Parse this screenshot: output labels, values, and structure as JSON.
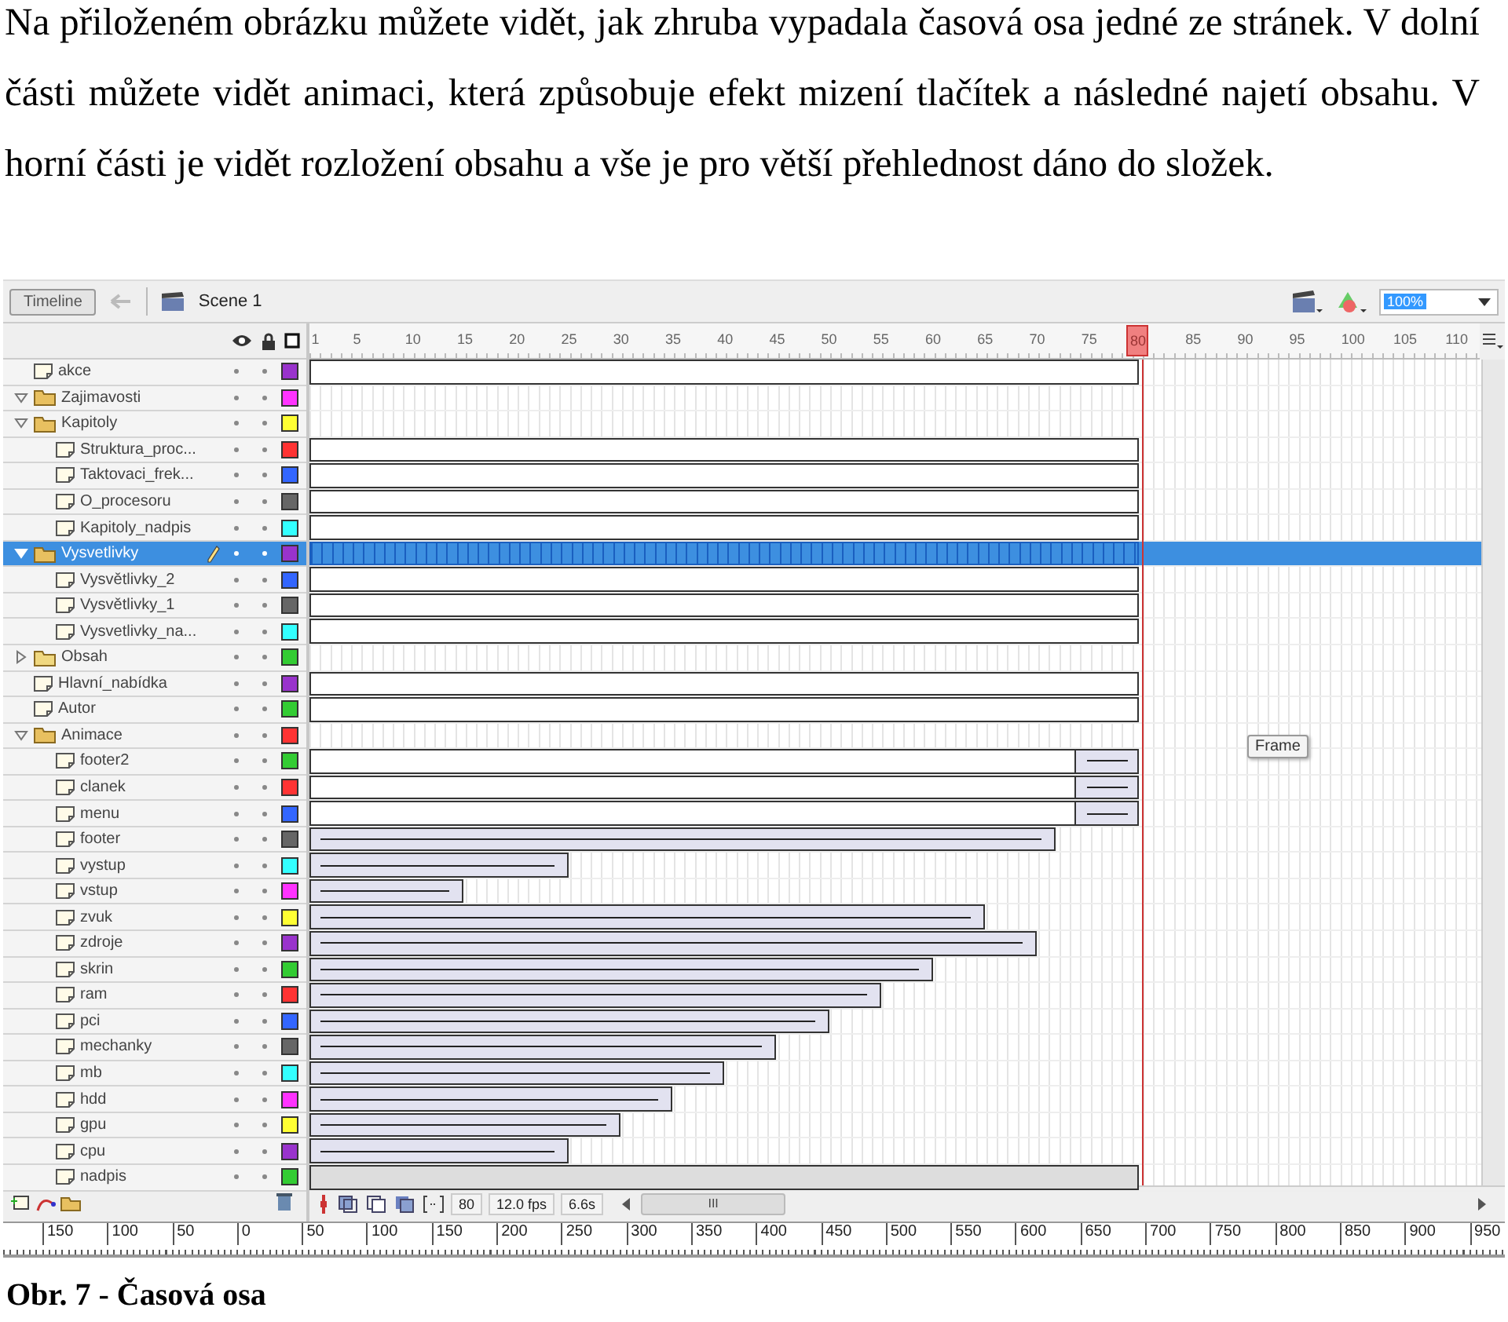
{
  "paragraph": "Na přiloženém obrázku můžete vidět, jak zhruba vypadala časová osa jedné ze stránek. V dolní části můžete vidět animaci, která způsobuje efekt mizení tlačítek a následné najetí obsahu. V horní části je vidět rozložení obsahu a vše je pro větší přehlednost dáno do složek.",
  "timeline": {
    "tab": "Timeline",
    "scene": "Scene 1",
    "zoom": "100%",
    "ruler": [
      "1",
      "5",
      "10",
      "15",
      "20",
      "25",
      "30",
      "35",
      "40",
      "45",
      "50",
      "55",
      "60",
      "65",
      "70",
      "75",
      "80",
      "85",
      "90",
      "95",
      "100",
      "105",
      "110"
    ],
    "layers": [
      {
        "name": "akce",
        "kind": "layer",
        "color": "#9933cc",
        "selected": false,
        "span": {
          "kind": "static",
          "level": 0.708
        }
      },
      {
        "name": "Zajimavosti",
        "kind": "folder",
        "expanded": true,
        "color": "#ff33ff",
        "selected": false
      },
      {
        "name": "Kapitoly",
        "kind": "folder",
        "expanded": true,
        "color": "#ffff33",
        "selected": false,
        "children": [
          {
            "name": "Struktura_proc...",
            "kind": "layer",
            "color": "#ff3333",
            "selected": false,
            "span": {
              "kind": "static",
              "level": 0.708
            }
          },
          {
            "name": "Taktovaci_frek...",
            "kind": "layer",
            "color": "#3366ff",
            "selected": false,
            "span": {
              "kind": "static",
              "level": 0.708
            }
          },
          {
            "name": "O_procesoru",
            "kind": "layer",
            "color": "#666666",
            "selected": false,
            "span": {
              "kind": "static",
              "level": 0.708
            }
          },
          {
            "name": "Kapitoly_nadpis",
            "kind": "layer",
            "color": "#33ffff",
            "selected": false,
            "span": {
              "kind": "static",
              "level": 0.708
            }
          }
        ]
      },
      {
        "name": "Vysvetlivky",
        "kind": "folder",
        "expanded": true,
        "color": "#9933cc",
        "selected": true,
        "span": {
          "kind": "selected",
          "level": 0.708
        },
        "children": [
          {
            "name": "Vysvětlivky_2",
            "kind": "layer",
            "color": "#3366ff",
            "selected": false,
            "span": {
              "kind": "static",
              "level": 0.708
            }
          },
          {
            "name": "Vysvětlivky_1",
            "kind": "layer",
            "color": "#666666",
            "selected": false,
            "span": {
              "kind": "static",
              "level": 0.708
            }
          },
          {
            "name": "Vysvetlivky_na...",
            "kind": "layer",
            "color": "#33ffff",
            "selected": false,
            "span": {
              "kind": "static",
              "level": 0.708
            }
          }
        ]
      },
      {
        "name": "Obsah",
        "kind": "folder",
        "expanded": false,
        "color": "#33cc33",
        "selected": false
      },
      {
        "name": "Hlavní_nabídka",
        "kind": "layer",
        "color": "#9933cc",
        "selected": false,
        "span": {
          "kind": "static",
          "level": 0.708
        }
      },
      {
        "name": "Autor",
        "kind": "layer",
        "color": "#33cc33",
        "selected": false,
        "span": {
          "kind": "static",
          "level": 0.708
        }
      },
      {
        "name": "Animace",
        "kind": "folder",
        "expanded": true,
        "color": "#ff3333",
        "selected": false,
        "children": [
          {
            "name": "footer2",
            "kind": "layer",
            "color": "#33cc33",
            "selected": false,
            "span": {
              "kind": "static_tween",
              "level": 0.708
            }
          },
          {
            "name": "clanek",
            "kind": "layer",
            "color": "#ff3333",
            "selected": false,
            "span": {
              "kind": "static_tween",
              "level": 0.708
            }
          },
          {
            "name": "menu",
            "kind": "layer",
            "color": "#3366ff",
            "selected": false,
            "span": {
              "kind": "static_tween",
              "level": 0.708
            }
          },
          {
            "name": "footer",
            "kind": "layer",
            "color": "#666666",
            "selected": false,
            "span": {
              "kind": "tween",
              "level": 0.637
            }
          },
          {
            "name": "vystup",
            "kind": "layer",
            "color": "#33ffff",
            "selected": false,
            "span": {
              "kind": "tween",
              "level": 0.221
            }
          },
          {
            "name": "vstup",
            "kind": "layer",
            "color": "#ff33ff",
            "selected": false,
            "span": {
              "kind": "tween",
              "level": 0.131
            }
          },
          {
            "name": "zvuk",
            "kind": "layer",
            "color": "#ffff33",
            "selected": false,
            "span": {
              "kind": "tween",
              "level": 0.576
            }
          },
          {
            "name": "zdroje",
            "kind": "layer",
            "color": "#9933cc",
            "selected": false,
            "span": {
              "kind": "tween",
              "level": 0.621
            }
          },
          {
            "name": "skrin",
            "kind": "layer",
            "color": "#33cc33",
            "selected": false,
            "span": {
              "kind": "tween",
              "level": 0.532
            }
          },
          {
            "name": "ram",
            "kind": "layer",
            "color": "#ff3333",
            "selected": false,
            "span": {
              "kind": "tween",
              "level": 0.488
            }
          },
          {
            "name": "pci",
            "kind": "layer",
            "color": "#3366ff",
            "selected": false,
            "span": {
              "kind": "tween",
              "level": 0.444
            }
          },
          {
            "name": "mechanky",
            "kind": "layer",
            "color": "#666666",
            "selected": false,
            "span": {
              "kind": "tween",
              "level": 0.398
            }
          },
          {
            "name": "mb",
            "kind": "layer",
            "color": "#33ffff",
            "selected": false,
            "span": {
              "kind": "tween",
              "level": 0.354
            }
          },
          {
            "name": "hdd",
            "kind": "layer",
            "color": "#ff33ff",
            "selected": false,
            "span": {
              "kind": "tween",
              "level": 0.31
            }
          },
          {
            "name": "gpu",
            "kind": "layer",
            "color": "#ffff33",
            "selected": false,
            "span": {
              "kind": "tween",
              "level": 0.265
            }
          },
          {
            "name": "cpu",
            "kind": "layer",
            "color": "#9933cc",
            "selected": false,
            "span": {
              "kind": "tween",
              "level": 0.221
            }
          },
          {
            "name": "nadpis",
            "kind": "layer",
            "color": "#33cc33",
            "selected": false,
            "span": {
              "kind": "filled",
              "level": 0.708
            }
          }
        ]
      }
    ],
    "tooltip": "Frame",
    "status": {
      "frame": "80",
      "fps": "12.0 fps",
      "time": "6.6s",
      "scroll_grip": "III"
    },
    "pixel_ruler": [
      "150",
      "100",
      "50",
      "0",
      "50",
      "100",
      "150",
      "200",
      "250",
      "300",
      "350",
      "400",
      "450",
      "500",
      "550",
      "600",
      "650",
      "700",
      "750",
      "800",
      "850",
      "900",
      "950"
    ]
  },
  "caption": "Obr. 7 - Časová osa"
}
